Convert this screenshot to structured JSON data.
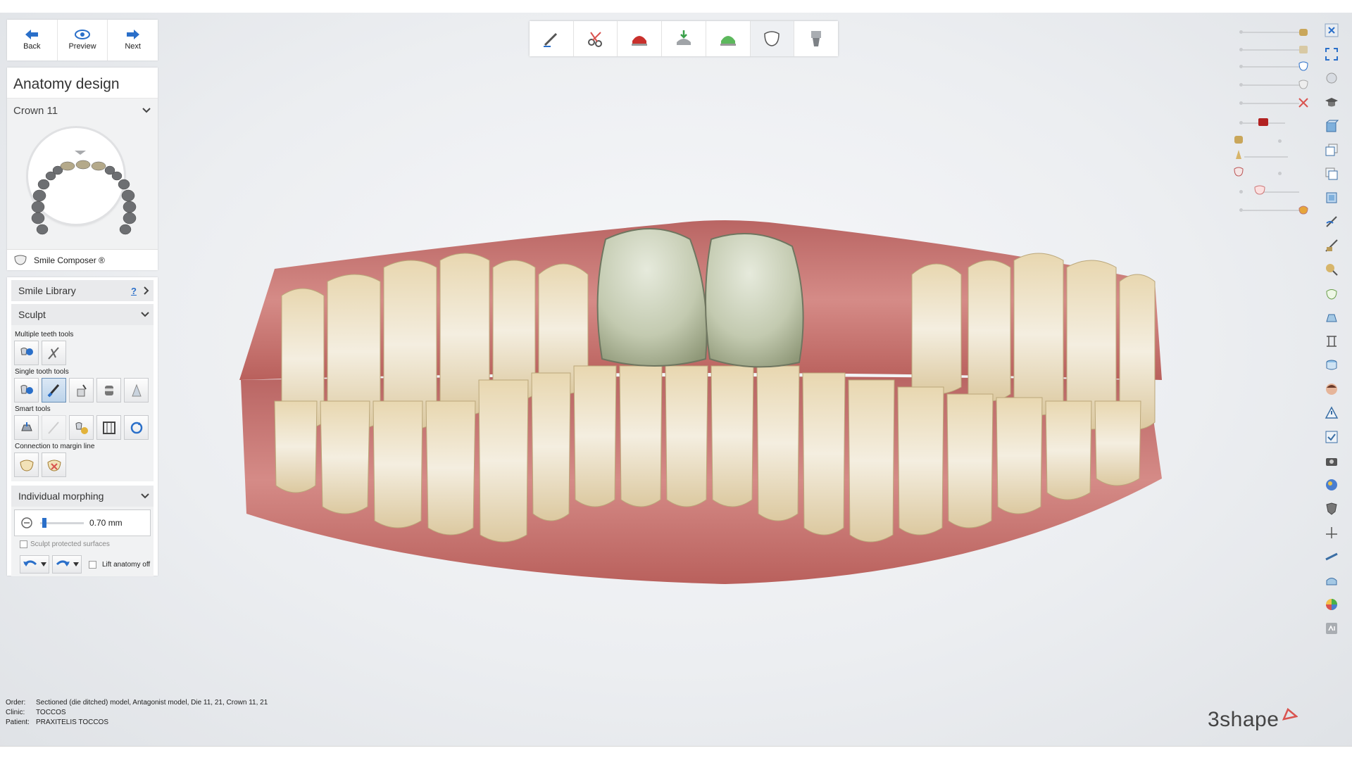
{
  "nav": {
    "back": "Back",
    "preview": "Preview",
    "next": "Next"
  },
  "panel": {
    "title": "Anatomy design",
    "crown": "Crown 11",
    "smile_composer": "Smile Composer ®"
  },
  "tools": {
    "smile_library": "Smile Library",
    "help": "?",
    "sculpt": "Sculpt",
    "multiple": "Multiple teeth tools",
    "single": "Single tooth tools",
    "smart": "Smart tools",
    "connection": "Connection to margin line",
    "morphing": "Individual morphing",
    "morph_value": "0.70 mm",
    "sculpt_protected": "Sculpt protected surfaces",
    "lift_anatomy": "Lift anatomy off"
  },
  "info": {
    "order_label": "Order:",
    "order": "Sectioned (die ditched) model, Antagonist model, Die 11, 21, Crown 11, 21",
    "clinic_label": "Clinic:",
    "clinic": "TOCCOS",
    "patient_label": "Patient:",
    "patient": "PRAXITELIS TOCCOS"
  },
  "brand": "3shape",
  "colors": {
    "accent": "#2a6fc9",
    "brand_arrow": "#d9534f",
    "gum": "#c47a78",
    "crown": "#c9cfb8"
  },
  "morph_level": 0.05
}
